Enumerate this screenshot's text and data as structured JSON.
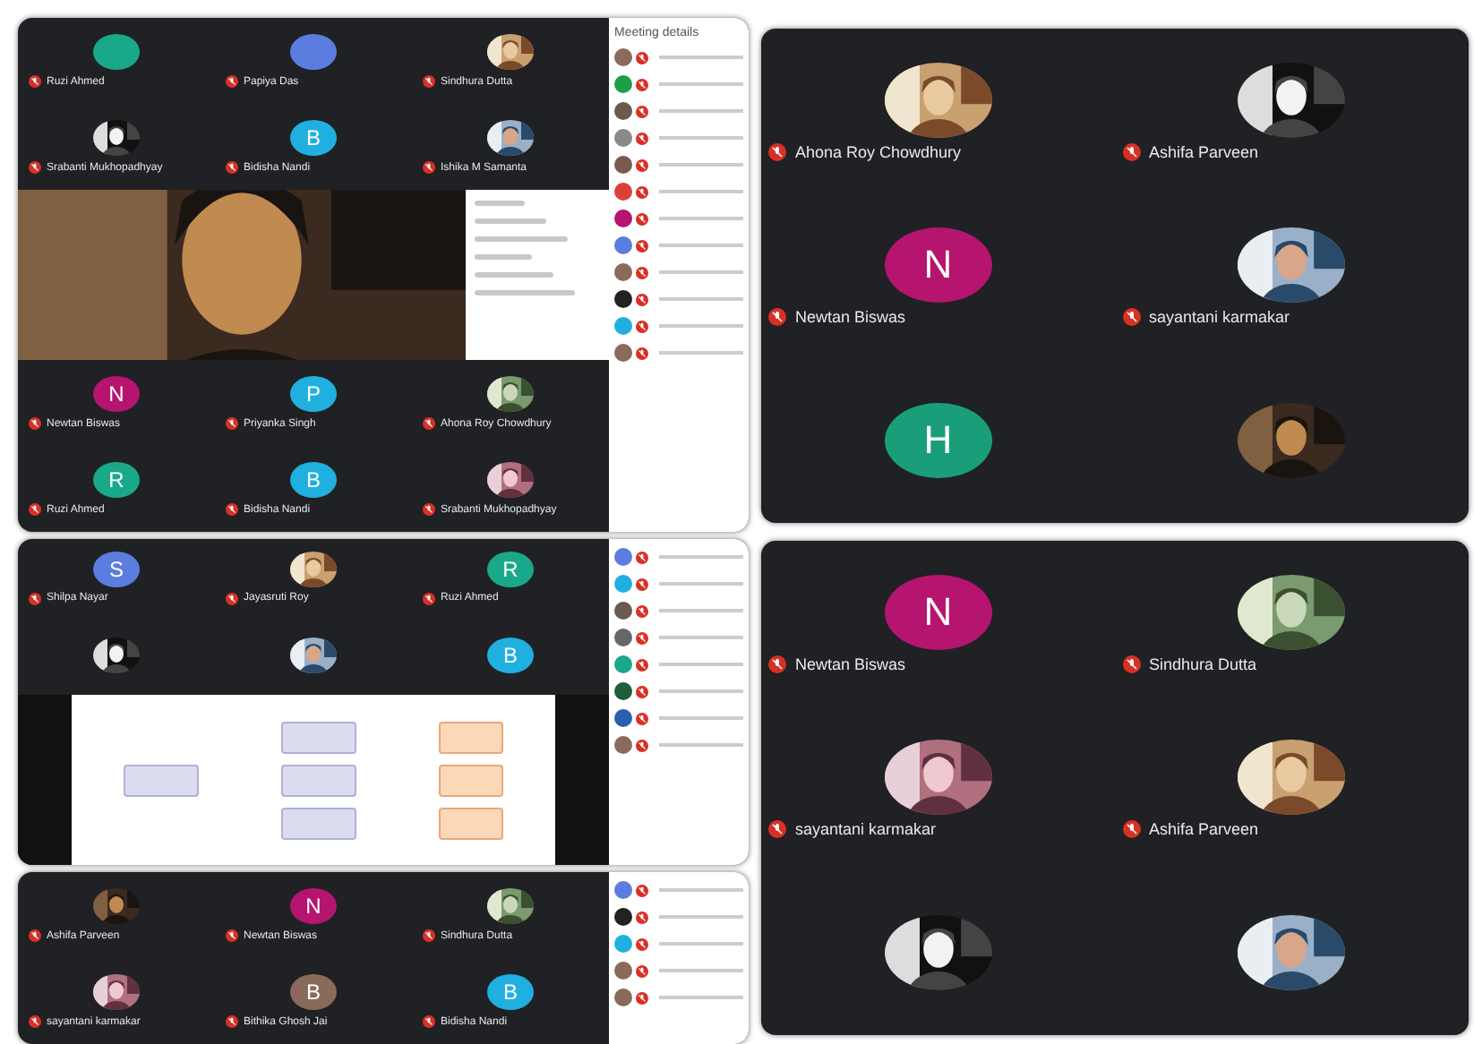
{
  "screenshots": [
    {
      "kind": "gallery",
      "rows": [
        [
          {
            "name": "Ruzi Ahmed",
            "avatar": {
              "kind": "letter",
              "color": "#1aa88a"
            }
          },
          {
            "name": "Papiya Das",
            "avatar": {
              "kind": "letter",
              "color": "#5c7de0"
            }
          },
          {
            "name": "Sindhura Dutta",
            "avatar": {
              "kind": "picture"
            }
          }
        ],
        [
          {
            "name": "Srabanti Mukhopadhyay",
            "avatar": {
              "kind": "picture"
            }
          },
          {
            "name": "Bidisha Nandi",
            "avatar": {
              "kind": "letter",
              "letter": "B",
              "color": "#1fb0e0"
            }
          },
          {
            "name": "Ishika M Samanta",
            "avatar": {
              "kind": "picture"
            }
          }
        ],
        {
          "kind": "video"
        },
        [
          {
            "name": "Newtan Biswas",
            "avatar": {
              "kind": "letter",
              "letter": "N",
              "color": "#b5146f"
            }
          },
          {
            "name": "Priyanka Singh",
            "avatar": {
              "kind": "letter",
              "letter": "P",
              "color": "#1fb0e0"
            }
          },
          {
            "name": "Ahona Roy Chowdhury",
            "avatar": {
              "kind": "picture"
            }
          }
        ],
        [
          {
            "name": "Ruzi Ahmed",
            "avatar": {
              "kind": "letter",
              "letter": "R",
              "color": "#1aa88a"
            }
          },
          {
            "name": "Bidisha Nandi",
            "avatar": {
              "kind": "letter",
              "letter": "B",
              "color": "#1fb0e0"
            }
          },
          {
            "name": "Srabanti Mukhopadhyay",
            "avatar": {
              "kind": "picture"
            }
          }
        ]
      ],
      "sidebar": {
        "heading": "Meeting details",
        "rows": [
          {
            "color": "#8a6a5a"
          },
          {
            "color": "#1e9e4a"
          },
          {
            "color": "#6a5a50"
          },
          {
            "color": "#8a8a8a"
          },
          {
            "color": "#7a5a50"
          },
          {
            "color": "#d9403a"
          },
          {
            "color": "#b5146f"
          },
          {
            "color": "#5c7de0"
          },
          {
            "color": "#8a6a5a"
          },
          {
            "color": "#222222"
          },
          {
            "color": "#1fb0e0"
          },
          {
            "color": "#8a6a5a"
          }
        ]
      }
    },
    {
      "kind": "gallery",
      "rows": [
        [
          {
            "name": "Shilpa Nayar",
            "avatar": {
              "kind": "letter",
              "letter": "S",
              "color": "#5c7de0"
            }
          },
          {
            "name": "Jayasruti Roy",
            "avatar": {
              "kind": "picture"
            }
          },
          {
            "name": "Ruzi Ahmed",
            "avatar": {
              "kind": "letter",
              "letter": "R",
              "color": "#1aa88a"
            }
          }
        ],
        [
          {
            "avatar": {
              "kind": "picture"
            }
          },
          {
            "avatar": {
              "kind": "picture"
            }
          },
          {
            "avatar": {
              "kind": "letter",
              "letter": "B",
              "color": "#1fb0e0"
            }
          }
        ],
        {
          "kind": "slide"
        }
      ],
      "sidebar": {
        "rows": [
          {
            "color": "#5c7de0"
          },
          {
            "color": "#1fb0e0"
          },
          {
            "color": "#6a5a50"
          },
          {
            "color": "#666666"
          },
          {
            "color": "#1aa88a"
          },
          {
            "color": "#1e5e3a"
          },
          {
            "color": "#2a5fb0"
          },
          {
            "color": "#8a6a5a"
          }
        ]
      }
    },
    {
      "kind": "gallery",
      "rows": [
        [
          {
            "name": "Ashifa Parveen",
            "avatar": {
              "kind": "picture"
            }
          },
          {
            "name": "Newtan Biswas",
            "avatar": {
              "kind": "letter",
              "letter": "N",
              "color": "#b5146f"
            }
          },
          {
            "name": "Sindhura Dutta",
            "avatar": {
              "kind": "picture"
            }
          }
        ],
        [
          {
            "name": "sayantani karmakar",
            "avatar": {
              "kind": "picture"
            }
          },
          {
            "name": "Bithika Ghosh Jai",
            "avatar": {
              "kind": "letter",
              "letter": "B",
              "color": "#8a6a5a"
            }
          },
          {
            "name": "Bidisha Nandi",
            "avatar": {
              "kind": "letter",
              "letter": "B",
              "color": "#1fb0e0"
            }
          }
        ]
      ],
      "sidebar": {
        "rows": [
          {
            "color": "#5c7de0"
          },
          {
            "color": "#222222"
          },
          {
            "color": "#1fb0e0"
          },
          {
            "color": "#8a6a5a"
          },
          {
            "color": "#8a6a5a"
          }
        ]
      }
    },
    {
      "kind": "large",
      "rows": [
        [
          {
            "name": "Ahona Roy Chowdhury",
            "avatar": {
              "kind": "picture"
            }
          },
          {
            "name": "Ashifa Parveen",
            "avatar": {
              "kind": "picture"
            }
          }
        ],
        [
          {
            "name": "Newtan Biswas",
            "avatar": {
              "kind": "letter",
              "letter": "N",
              "color": "#b5146f"
            }
          },
          {
            "name": "sayantani karmakar",
            "avatar": {
              "kind": "picture"
            }
          }
        ],
        [
          {
            "avatar": {
              "kind": "letter",
              "letter": "H",
              "color": "#1a9e7a"
            }
          },
          {
            "avatar": {
              "kind": "picture"
            }
          }
        ]
      ]
    },
    {
      "kind": "large",
      "rows": [
        [
          {
            "name": "Newtan Biswas",
            "avatar": {
              "kind": "letter",
              "letter": "N",
              "color": "#b5146f"
            }
          },
          {
            "name": "Sindhura Dutta",
            "avatar": {
              "kind": "picture"
            }
          }
        ],
        [
          {
            "name": "sayantani karmakar",
            "avatar": {
              "kind": "picture"
            }
          },
          {
            "name": "Ashifa Parveen",
            "avatar": {
              "kind": "picture"
            }
          }
        ],
        [
          {
            "avatar": {
              "kind": "picture"
            }
          },
          {
            "avatar": {
              "kind": "picture"
            }
          }
        ]
      ]
    }
  ]
}
